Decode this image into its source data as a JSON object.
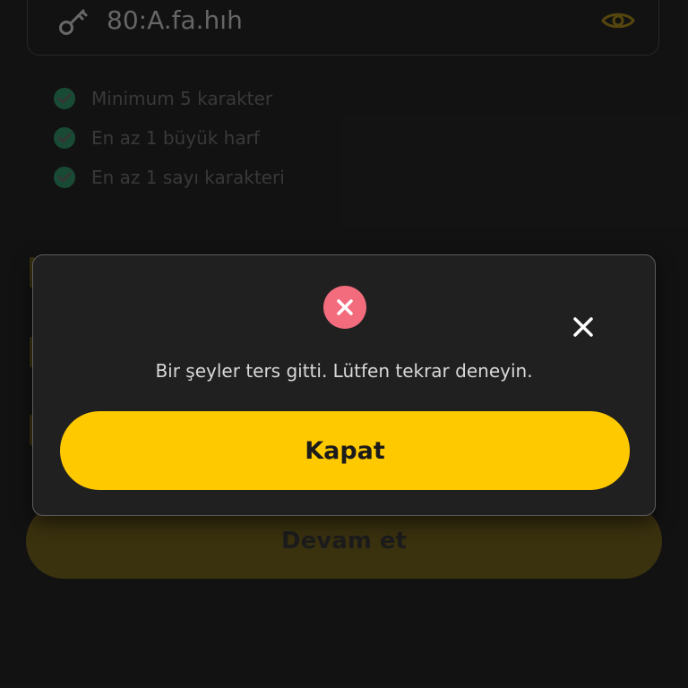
{
  "password_field": {
    "value": "80:A.fa.hıh",
    "key_icon": "key-icon",
    "eye_icon": "eye-icon"
  },
  "requirements": [
    "Minimum 5 karakter",
    "En az 1 büyük harf",
    "En az 1 sayı karakteri"
  ],
  "continue_button": {
    "label": "Devam et"
  },
  "dialog": {
    "icon": "error-icon",
    "close_icon": "close-icon",
    "message": "Bir şeyler ters gitti. Lütfen tekrar deneyin.",
    "button_label": "Kapat"
  },
  "colors": {
    "accent": "#ffc900",
    "error": "#f26c7e",
    "success": "#1f6b4b",
    "background": "#141414",
    "dialog_background": "#202020"
  }
}
